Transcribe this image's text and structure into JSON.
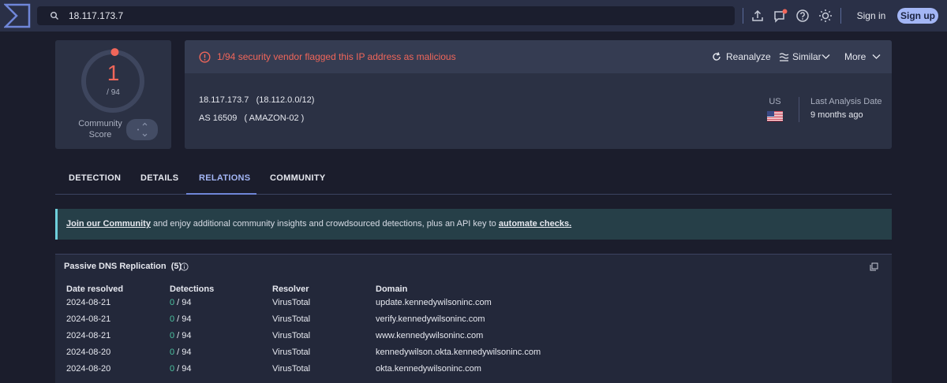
{
  "search": {
    "value": "18.117.173.7"
  },
  "auth": {
    "signin": "Sign in",
    "signup": "Sign up"
  },
  "score": {
    "detections": "1",
    "total": "/ 94",
    "community_label_1": "Community",
    "community_label_2": "Score",
    "ratio": 0.0106
  },
  "alert": {
    "text": "1/94 security vendor flagged this IP address as malicious"
  },
  "actions": {
    "reanalyze": "Reanalyze",
    "similar": "Similar",
    "more": "More"
  },
  "ip": {
    "address": "18.117.173.7",
    "network": "(18.112.0.0/12)",
    "as_number": "AS 16509",
    "as_owner": "( AMAZON-02 )"
  },
  "geo": {
    "country": "US",
    "last_analysis_label": "Last Analysis Date",
    "last_analysis_value": "9 months ago"
  },
  "tabs": [
    "DETECTION",
    "DETAILS",
    "RELATIONS",
    "COMMUNITY"
  ],
  "banner": {
    "link1": "Join our Community",
    "middle": " and enjoy additional community insights and crowdsourced detections, plus an API key to ",
    "link2": "automate checks."
  },
  "dns": {
    "title": "Passive DNS Replication",
    "count": "(5)",
    "headers": {
      "date": "Date resolved",
      "detections": "Detections",
      "resolver": "Resolver",
      "domain": "Domain"
    },
    "rows": [
      {
        "date": "2024-08-21",
        "det": "0",
        "total": " / 94",
        "resolver": "VirusTotal",
        "domain": "update.kennedywilsoninc.com"
      },
      {
        "date": "2024-08-21",
        "det": "0",
        "total": " / 94",
        "resolver": "VirusTotal",
        "domain": "verify.kennedywilsoninc.com"
      },
      {
        "date": "2024-08-21",
        "det": "0",
        "total": " / 94",
        "resolver": "VirusTotal",
        "domain": "www.kennedywilsoninc.com"
      },
      {
        "date": "2024-08-20",
        "det": "0",
        "total": " / 94",
        "resolver": "VirusTotal",
        "domain": "kennedywilson.okta.kennedywilsoninc.com"
      },
      {
        "date": "2024-08-20",
        "det": "0",
        "total": " / 94",
        "resolver": "VirusTotal",
        "domain": "okta.kennedywilsoninc.com"
      }
    ]
  },
  "colors": {
    "malicious": "#f0665a",
    "accent": "#a3b6f5",
    "clean": "#4cc3a0"
  }
}
